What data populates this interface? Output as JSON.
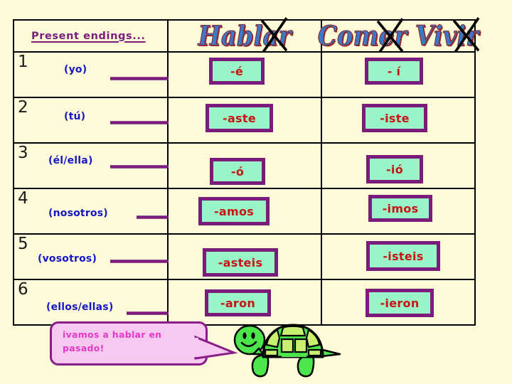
{
  "slide": {
    "background_color": "#FDFBD8"
  },
  "table": {
    "header": {
      "pronoun_column_label": "Present endings...",
      "ar_column": {
        "verb": "Hablar",
        "stem": "Habl",
        "crossed_ending": "ar"
      },
      "er_ir_column": {
        "verb_1_stem": "Com",
        "verb_1_crossed_ending": "er",
        "verb_2_stem": "Viv",
        "verb_2_crossed_ending": "ir"
      }
    },
    "rows": [
      {
        "number": "1",
        "pronoun": "(yo)",
        "ar_ending": "-é",
        "er_ir_ending": "- í"
      },
      {
        "number": "2",
        "pronoun": "(tú)",
        "ar_ending": "-aste",
        "er_ir_ending": "-iste"
      },
      {
        "number": "3",
        "pronoun": "(él/ella)",
        "ar_ending": "-ó",
        "er_ir_ending": "-ió"
      },
      {
        "number": "4",
        "pronoun": "(nosotros)",
        "ar_ending": "-amos",
        "er_ir_ending": "-imos"
      },
      {
        "number": "5",
        "pronoun": "(vosotros)",
        "ar_ending": "-asteis",
        "er_ir_ending": "-isteis"
      },
      {
        "number": "6",
        "pronoun": "(ellos/ellas)",
        "ar_ending": "-aron",
        "er_ir_ending": "-ieron"
      }
    ]
  },
  "callout": {
    "text": "ivamos a hablar en pasado!"
  },
  "colors": {
    "background": "#FDFBD8",
    "header_text": "#7B1B7B",
    "pronoun_text": "#1717C7",
    "ending_text": "#C81414",
    "chip_fill": "#99F5C8",
    "chip_border": "#7B1B7B",
    "arrow": "#7B1B7B",
    "wordart_fill": "#3C78C8",
    "wordart_shadow": "#A03030",
    "bubble_fill": "#F7C8F0",
    "bubble_border": "#8B1C8B",
    "bubble_text": "#E339C8",
    "turtle_body": "#4CE64C",
    "turtle_shell_light": "#C8F06E"
  }
}
